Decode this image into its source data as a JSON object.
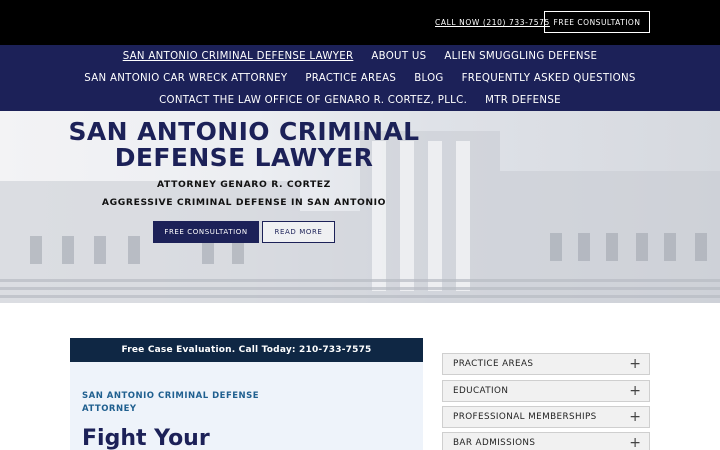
{
  "topbar": {
    "call_label": "CALL NOW (210) 733-7575",
    "cta_label": "FREE CONSULTATION"
  },
  "nav": {
    "items": [
      {
        "label": "SAN ANTONIO CRIMINAL DEFENSE LAWYER",
        "active": true
      },
      {
        "label": "ABOUT US"
      },
      {
        "label": "ALIEN SMUGGLING DEFENSE"
      },
      {
        "label": "SAN ANTONIO CAR WRECK ATTORNEY"
      },
      {
        "label": "PRACTICE AREAS"
      },
      {
        "label": "BLOG"
      },
      {
        "label": "FREQUENTLY ASKED QUESTIONS"
      },
      {
        "label": "CONTACT THE LAW OFFICE OF GENARO R. CORTEZ, PLLC."
      },
      {
        "label": "MTR DEFENSE"
      }
    ]
  },
  "hero": {
    "title": "SAN ANTONIO CRIMINAL DEFENSE LAWYER",
    "subtitle1": "ATTORNEY GENARO R. CORTEZ",
    "subtitle2": "AGGRESSIVE CRIMINAL DEFENSE IN SAN ANTONIO",
    "primary_button": "FREE CONSULTATION",
    "secondary_button": "READ MORE"
  },
  "content": {
    "eval_bar": "Free Case Evaluation. Call Today: 210-733-7575",
    "section_label": "SAN ANTONIO CRIMINAL DEFENSE ATTORNEY",
    "heading": "Fight Your"
  },
  "sidebar": {
    "accordion": [
      {
        "label": "PRACTICE AREAS",
        "icon": "plus-icon"
      },
      {
        "label": "EDUCATION",
        "icon": "plus-icon"
      },
      {
        "label": "PROFESSIONAL MEMBERSHIPS",
        "icon": "plus-icon"
      },
      {
        "label": "BAR ADMISSIONS",
        "icon": "plus-icon"
      }
    ]
  },
  "colors": {
    "navy": "#1c2158",
    "dark_bar": "#0f2744",
    "label_blue": "#1f5f8f",
    "black": "#000000"
  }
}
